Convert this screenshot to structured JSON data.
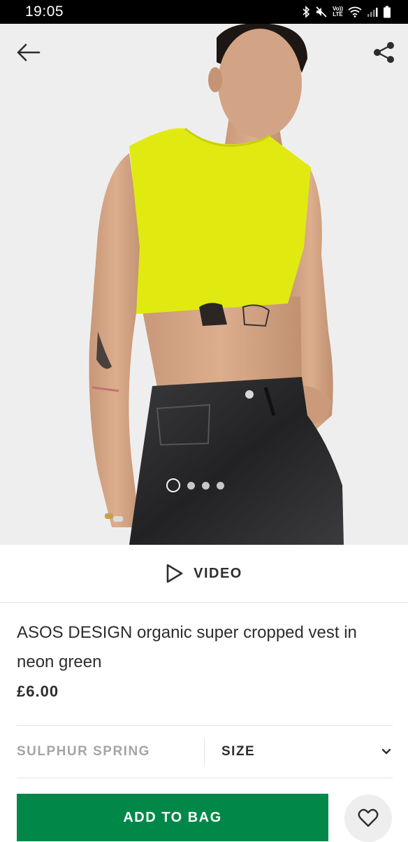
{
  "status_bar": {
    "time": "19:05",
    "icons": [
      "bluetooth-icon",
      "mute-icon",
      "volte-icon",
      "wifi-icon",
      "signal-icon",
      "battery-icon"
    ],
    "volte_text_top": "Vo))",
    "volte_text_bottom": "LTE"
  },
  "gallery": {
    "image_count": 4,
    "active_index": 0
  },
  "video": {
    "label": "VIDEO"
  },
  "product": {
    "title": "ASOS DESIGN organic super cropped vest in neon green",
    "price": "£6.00",
    "colour": "SULPHUR SPRING",
    "size_label": "SIZE"
  },
  "actions": {
    "add_to_bag": "ADD TO BAG"
  },
  "colors": {
    "accent_green": "#018849",
    "vest": "#e0ea10",
    "background": "#eeeeef"
  }
}
